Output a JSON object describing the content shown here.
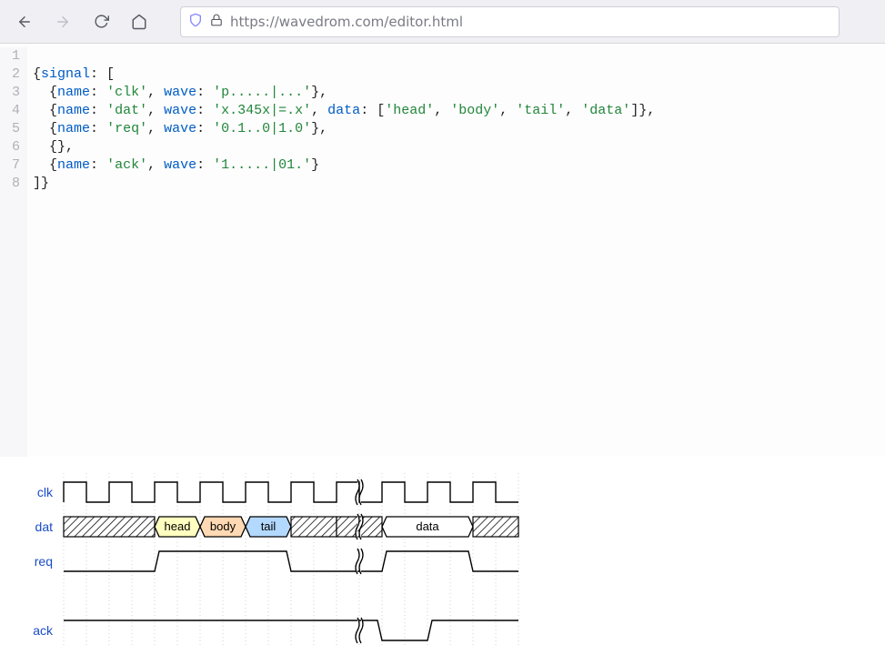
{
  "browser": {
    "url": "https://wavedrom.com/editor.html"
  },
  "editor": {
    "line_count": 8,
    "lines": {
      "l1": "{signal: [",
      "l2a": "name",
      "l2b": "'clk'",
      "l2c": "wave",
      "l2d": "'p.....|...'",
      "l3a": "name",
      "l3b": "'dat'",
      "l3c": "wave",
      "l3d": "'x.345x|=.x'",
      "l3e": "data",
      "l3f": "'head'",
      "l3g": "'body'",
      "l3h": "'tail'",
      "l3i": "'data'",
      "l4a": "name",
      "l4b": "'req'",
      "l4c": "wave",
      "l4d": "'0.1..0|1.0'",
      "l5": "  {},",
      "l6a": "name",
      "l6b": "'ack'",
      "l6c": "wave",
      "l6d": "'1.....|01.'",
      "l7": "]}"
    }
  },
  "wave": {
    "signals": [
      "clk",
      "dat",
      "req",
      "ack"
    ],
    "dat_labels": [
      "head",
      "body",
      "tail",
      "data"
    ]
  }
}
